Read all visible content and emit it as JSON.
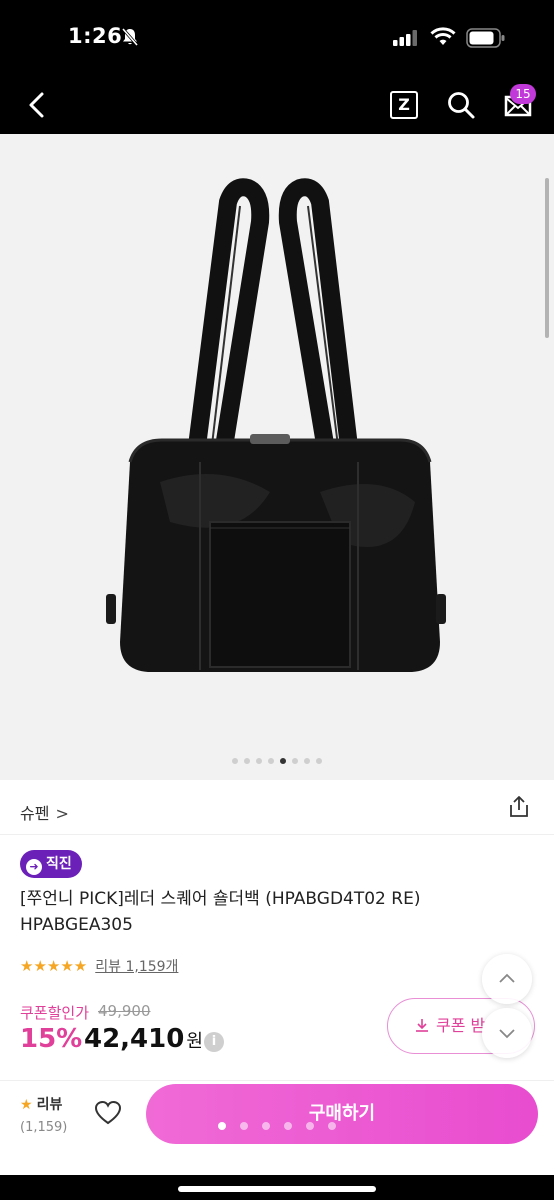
{
  "status": {
    "time": "1:26"
  },
  "nav": {
    "z_label": "Z",
    "badge_count": "15"
  },
  "gallery": {
    "dot_count": 8,
    "active_dot": 4
  },
  "product": {
    "brand": "슈펜",
    "brand_chevron": ">",
    "badge": "직진",
    "title": "[쭈언니 PICK]레더 스퀘어 숄더백 (HPABGD4T02 RE) HPABGEA305",
    "stars": "★★★★★",
    "review_link": "리뷰 1,159개",
    "coupon_price_label": "쿠폰할인가",
    "original_price": "49,900",
    "discount": "15%",
    "price": "42,410",
    "currency": "원",
    "info_icon": "i",
    "coupon_button": "쿠폰 받"
  },
  "bottom_bar": {
    "review_label": "리뷰",
    "review_count": "(1,159)",
    "buy_label": "구매하기"
  },
  "colors": {
    "accent": "#e0409a",
    "buy_gradient_start": "#f06ad6",
    "direct_badge": "#6b21b8",
    "star": "#f5a623"
  }
}
